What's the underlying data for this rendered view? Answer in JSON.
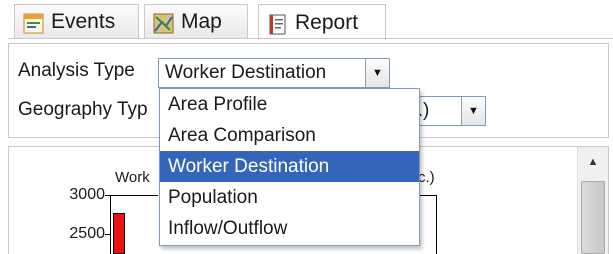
{
  "tabs": [
    {
      "label": "Events",
      "icon": "events-icon"
    },
    {
      "label": "Map",
      "icon": "map-icon"
    },
    {
      "label": "Report",
      "icon": "report-icon",
      "active": true
    }
  ],
  "controls": {
    "analysis_type_label": "Analysis Type",
    "analysis_type_value": "Worker Destination",
    "geography_type_label": "Geography Typ",
    "geography_type_value": "tc.)"
  },
  "dropdown": {
    "options": [
      "Area Profile",
      "Area Comparison",
      "Worker Destination",
      "Population",
      "Inflow/Outflow"
    ],
    "selected": "Worker Destination",
    "highlight_color": "#3366bb"
  },
  "chart": {
    "title_left_fragment": "Work",
    "title_right_fragment": "c.)",
    "y_ticks": [
      "3000",
      "2500"
    ],
    "bar_color": "#ee1111"
  }
}
